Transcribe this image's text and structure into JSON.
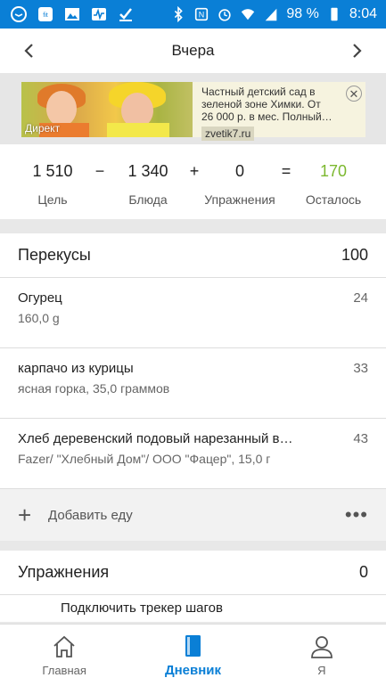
{
  "status": {
    "battery": "98 %",
    "time": "8:04"
  },
  "header": {
    "title": "Вчера"
  },
  "ad": {
    "label": "Директ",
    "text": "Частный детский сад в зеленой зоне Химки. От 26 000 р. в мес. Полный…",
    "domain": "zvetik7.ru",
    "close": "✕"
  },
  "summary": {
    "goal": {
      "value": "1 510",
      "label": "Цель"
    },
    "minus": "−",
    "food": {
      "value": "1 340",
      "label": "Блюда"
    },
    "plus": "+",
    "exercise": {
      "value": "0",
      "label": "Упражнения"
    },
    "equals": "=",
    "remaining": {
      "value": "170",
      "label": "Осталось",
      "color": "#7cb82f"
    }
  },
  "snacks": {
    "title": "Перекусы",
    "total": "100",
    "items": [
      {
        "name": "Огурец",
        "desc": "160,0 g",
        "cal": "24"
      },
      {
        "name": "карпачо из курицы",
        "desc": "ясная горка, 35,0 граммов",
        "cal": "33"
      },
      {
        "name": "Хлеб деревенский подовый нарезанный в…",
        "desc": "Fazer/ \"Хлебный Дом\"/ ООО \"Фацер\", 15,0 г",
        "cal": "43"
      }
    ],
    "add_label": "Добавить еду",
    "more": "•••"
  },
  "exercises": {
    "title": "Упражнения",
    "total": "0",
    "tracker_label": "Подключить трекер шагов"
  },
  "bottom_nav": {
    "home": "Главная",
    "diary": "Дневник",
    "me": "Я"
  },
  "colors": {
    "accent": "#0a7fd6",
    "remaining": "#7cb82f"
  }
}
